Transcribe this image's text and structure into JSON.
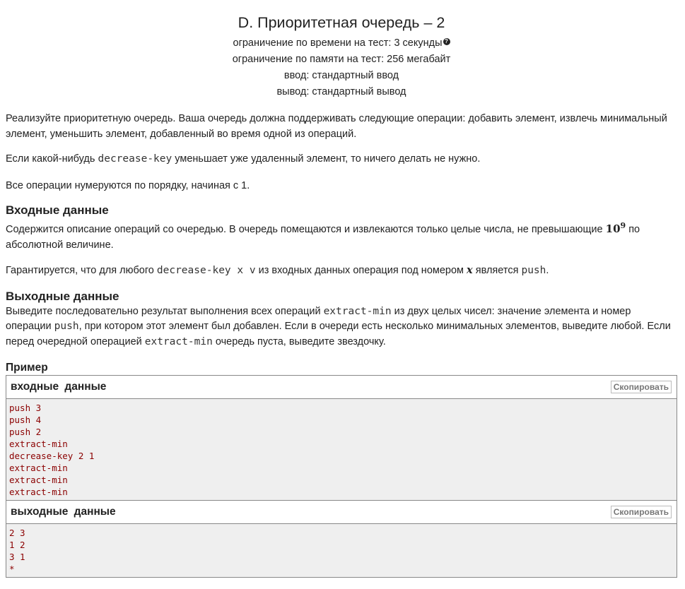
{
  "problem": {
    "title": "D. Приоритетная очередь – 2",
    "time_limit": "ограничение по времени на тест: 3 секунды",
    "memory_limit": "ограничение по памяти на тест: 256 мегабайт",
    "input": "ввод: стандартный ввод",
    "output": "вывод: стандартный вывод"
  },
  "statement": {
    "p1": "Реализуйте приоритетную очередь. Ваша очередь должна поддерживать следующие операции: добавить элемент, извлечь минимальный элемент, уменьшить элемент, добавленный во время одной из операций.",
    "p2_a": "Если какой-нибудь ",
    "p2_code": "decrease-key",
    "p2_b": " уменьшает уже удаленный элемент, то ничего делать не нужно.",
    "p3": "Все операции нумеруются по порядку, начиная с 1."
  },
  "input_section": {
    "heading": "Входные данные",
    "p1_a": "Содержится описание операций со очередью. В очередь помещаются и извлекаются только целые числа, не превышающие ",
    "p1_math_base": "10",
    "p1_math_exp": "9",
    "p1_b": " по абсолютной величине.",
    "p2_a": "Гарантируется, что для любого ",
    "p2_code": "decrease-key x v",
    "p2_b": " из входных данных операция под номером ",
    "p2_var": "x",
    "p2_c": " является ",
    "p2_code2": "push",
    "p2_d": "."
  },
  "output_section": {
    "heading": "Выходные данные",
    "p_a": "Выведите последовательно результат выполнения всех операций ",
    "p_code1": "extract-min",
    "p_b": " из двух целых чисел: значение элемента и номер операции ",
    "p_code2": "push",
    "p_c": ", при котором этот элемент был добавлен. Если в очереди есть несколько минимальных элементов, выведите любой. Если перед очередной операцией ",
    "p_code3": "extract-min",
    "p_d": " очередь пуста, выведите звездочку."
  },
  "sample": {
    "title": "Пример",
    "input_label": "входные данные",
    "output_label": "выходные данные",
    "copy_label": "Скопировать",
    "input_text": "push 3\npush 4\npush 2\nextract-min\ndecrease-key 2 1\nextract-min\nextract-min\nextract-min",
    "output_text": "2 3\n1 2\n3 1\n*"
  }
}
